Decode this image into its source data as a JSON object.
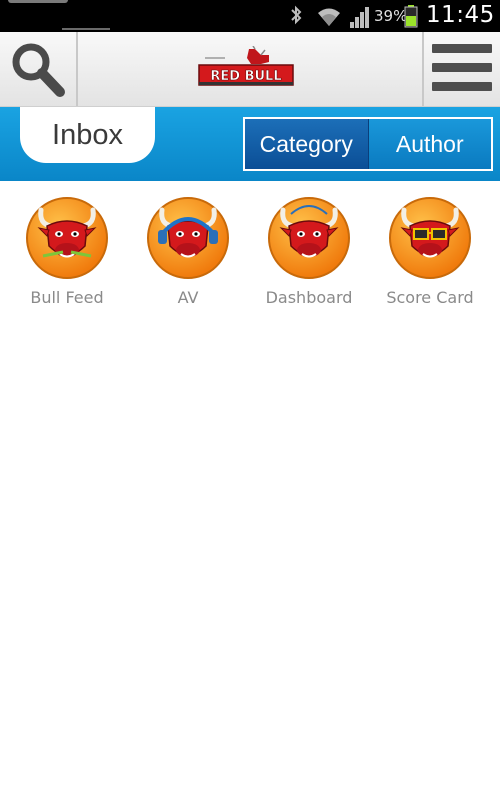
{
  "status_bar": {
    "battery_percent": "39%",
    "time": "11:45",
    "icons": [
      "bluetooth-icon",
      "wifi-icon",
      "signal-icon",
      "battery-icon"
    ]
  },
  "header": {
    "logo_text": "RED BULL",
    "left_icon": "search-icon",
    "right_icon": "menu-icon"
  },
  "tabs": {
    "inbox_label": "Inbox",
    "segments": [
      "Category",
      "Author"
    ],
    "selected": "Category"
  },
  "categories": [
    {
      "label": "Bull Feed",
      "icon": "bull-feed-icon"
    },
    {
      "label": "AV",
      "icon": "bull-headphones-icon"
    },
    {
      "label": "Dashboard",
      "icon": "bull-dashboard-icon"
    },
    {
      "label": "Score Card",
      "icon": "bull-glasses-icon"
    }
  ],
  "colors": {
    "accent_blue": "#0a86c8",
    "segment_active": "#0b4e96",
    "bull_red": "#d4191c",
    "avatar_orange": "#f7941d"
  }
}
